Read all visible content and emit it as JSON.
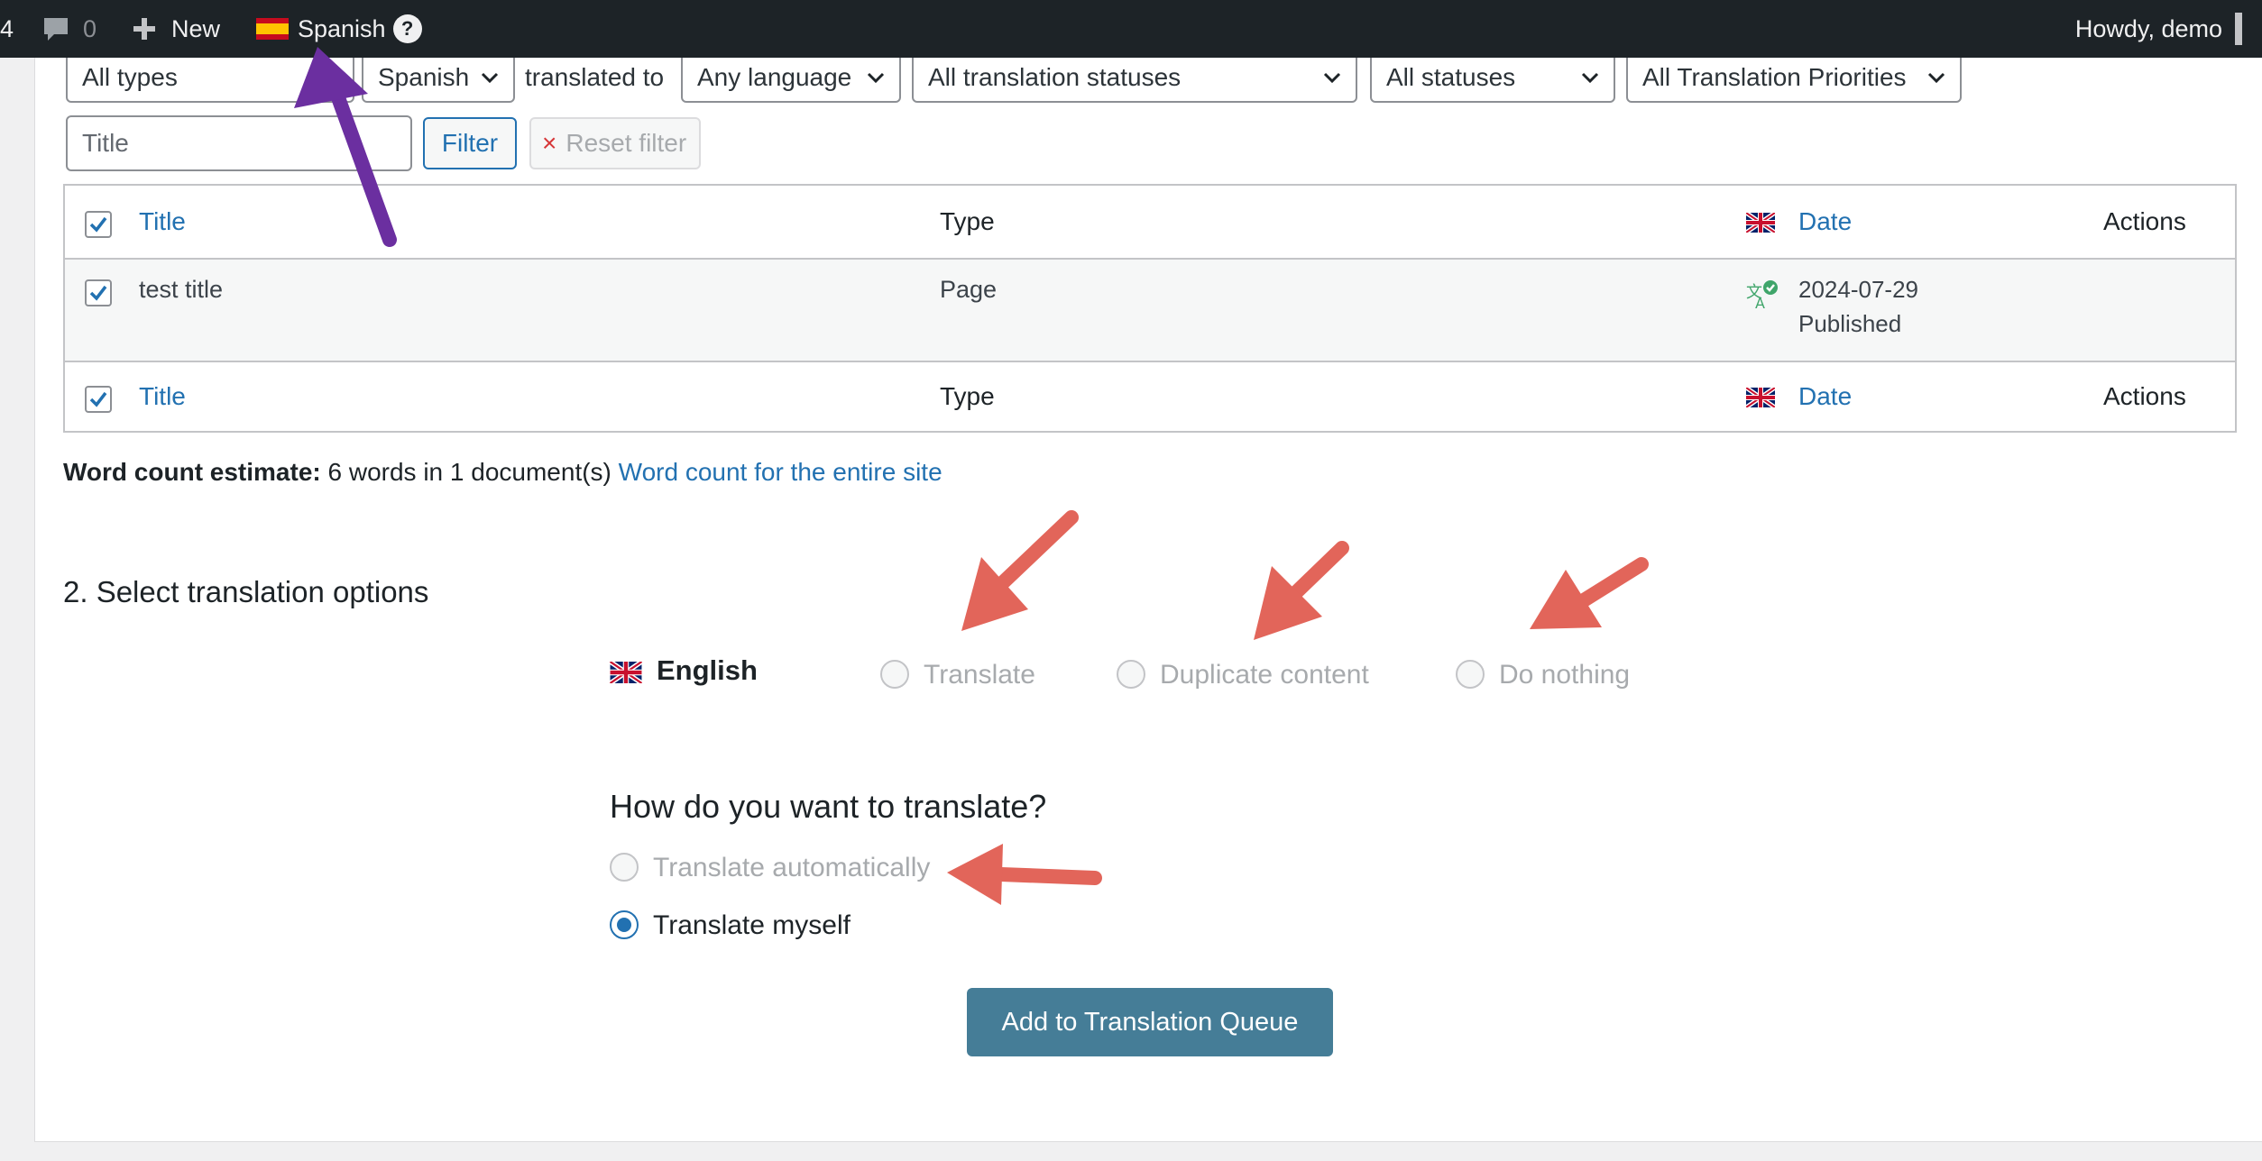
{
  "admin_bar": {
    "counter_fragment": "4",
    "comments_count": "0",
    "new_label": "New",
    "language_label": "Spanish",
    "help_label": "?",
    "greeting": "Howdy, demo"
  },
  "filters": {
    "type_select": "All types",
    "source_language_select": "Spanish",
    "translated_to_label": "translated to",
    "target_language_select": "Any language",
    "translation_status_select": "All translation statuses",
    "status_select": "All statuses",
    "priority_select": "All Translation Priorities",
    "title_placeholder": "Title",
    "filter_button": "Filter",
    "reset_button": "Reset filter",
    "reset_icon": "×"
  },
  "table": {
    "columns": {
      "title": "Title",
      "type": "Type",
      "date": "Date",
      "actions": "Actions"
    },
    "rows": [
      {
        "title": "test title",
        "type": "Page",
        "date": "2024-07-29",
        "status": "Published",
        "checked": true
      }
    ]
  },
  "word_count": {
    "label": "Word count estimate:",
    "text": "6 words in 1 document(s)",
    "link": "Word count for the entire site"
  },
  "options_section": {
    "heading": "2. Select translation options",
    "language": "English",
    "choices": [
      "Translate",
      "Duplicate content",
      "Do nothing"
    ],
    "method_heading": "How do you want to translate?",
    "methods": [
      {
        "label": "Translate automatically",
        "selected": false,
        "disabled": true
      },
      {
        "label": "Translate myself",
        "selected": true,
        "disabled": false
      }
    ]
  },
  "submit_button": "Add to Translation Queue",
  "colors": {
    "admin_bar_bg": "#1d2327",
    "link": "#2271b1",
    "primary_button": "#457d97",
    "annotation_purple": "#6b2fa0",
    "annotation_red": "#e2655a"
  }
}
